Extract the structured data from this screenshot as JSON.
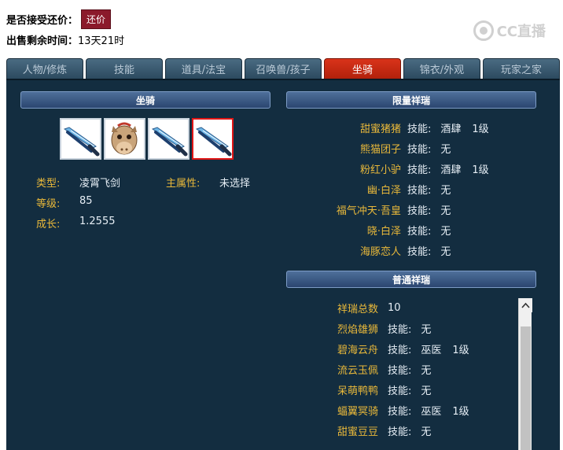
{
  "top": {
    "accept_bargain_label": "是否接受还价：",
    "bargain_button": "还价",
    "remaining_time_label": "出售剩余时间：",
    "remaining_time_value": "13天21时",
    "watermark_text": "CC直播"
  },
  "tabs": [
    {
      "label": "人物/修炼",
      "active": false
    },
    {
      "label": "技能",
      "active": false
    },
    {
      "label": "道具/法宝",
      "active": false
    },
    {
      "label": "召唤兽/孩子",
      "active": false
    },
    {
      "label": "坐骑",
      "active": true
    },
    {
      "label": "锦衣/外观",
      "active": false
    },
    {
      "label": "玩家之家",
      "active": false
    }
  ],
  "mount_section": {
    "header": "坐骑",
    "icons": [
      {
        "icon": "flying-sword-icon",
        "selected": false
      },
      {
        "icon": "horse-icon",
        "selected": false
      },
      {
        "icon": "flying-sword-icon",
        "selected": false
      },
      {
        "icon": "flying-sword-icon",
        "selected": true
      }
    ],
    "type_label": "类型:",
    "type_value": "凌霄飞剑",
    "main_attr_label": "主属性:",
    "main_attr_value": "未选择",
    "level_label": "等级:",
    "level_value": "85",
    "growth_label": "成长:",
    "growth_value": "1.2555"
  },
  "limited_section": {
    "header": "限量祥瑞",
    "skill_label": "技能:",
    "items": [
      {
        "name": "甜蜜猪猪",
        "skill": "酒肆",
        "level": "1级"
      },
      {
        "name": "熊猫团子",
        "skill": "无",
        "level": ""
      },
      {
        "name": "粉红小驴",
        "skill": "酒肆",
        "level": "1级"
      },
      {
        "name": "幽·白泽",
        "skill": "无",
        "level": ""
      },
      {
        "name": "福气冲天·吾皇",
        "skill": "无",
        "level": ""
      },
      {
        "name": "晓·白泽",
        "skill": "无",
        "level": ""
      },
      {
        "name": "海豚恋人",
        "skill": "无",
        "level": ""
      }
    ]
  },
  "normal_section": {
    "header": "普通祥瑞",
    "total_label": "祥瑞总数",
    "total_value": "10",
    "skill_label": "技能:",
    "items": [
      {
        "name": "烈焰雄狮",
        "skill": "无",
        "level": ""
      },
      {
        "name": "碧海云舟",
        "skill": "巫医",
        "level": "1级"
      },
      {
        "name": "流云玉佩",
        "skill": "无",
        "level": ""
      },
      {
        "name": "呆萌鸭鸭",
        "skill": "无",
        "level": ""
      },
      {
        "name": "蝠翼冥骑",
        "skill": "巫医",
        "level": "1级"
      },
      {
        "name": "甜蜜豆豆",
        "skill": "无",
        "level": ""
      }
    ]
  },
  "colors": {
    "panel_bg": "#132d40",
    "label_gold": "#e8b83a",
    "active_tab": "#d9331a",
    "bargain_button": "#8b1a2b"
  }
}
